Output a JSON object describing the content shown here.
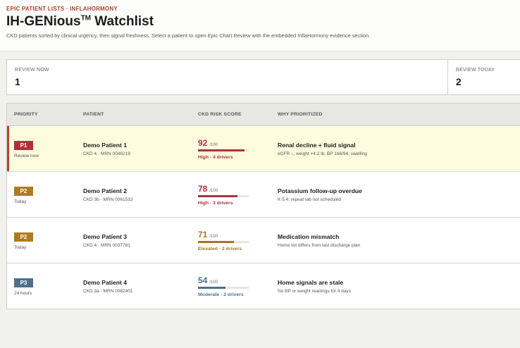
{
  "header": {
    "eyebrow": "EPIC PATIENT LISTS · INFLAHORMONY",
    "title": "IH-GENious",
    "title_mark": "TM",
    "title_rest": " Watchlist",
    "subtitle": "CKD patients sorted by clinical urgency, then signal freshness. Select a patient to open Epic Chart Review with the embedded InflaHormony evidence section."
  },
  "summary": {
    "review_now_label": "REVIEW NOW",
    "review_now_value": "1",
    "review_today_label": "REVIEW TODAY",
    "review_today_value": "2"
  },
  "table": {
    "columns": [
      "PRIORITY",
      "PATIENT",
      "CKD RISK SCORE",
      "WHY PRIORITIZED"
    ],
    "rows": [
      {
        "priority": "P1",
        "when": "Review now",
        "badge_color": "#b0303a",
        "name": "Demo Patient 1",
        "meta": "CKD 4 · MRN 0048219",
        "score": "92",
        "score_out_of": "/100",
        "score_fraction": 0.92,
        "score_color": "#a83242",
        "band": "High · 4 drivers",
        "why": "Renal decline + fluid signal",
        "detail": "eGFR ↓, weight +4.2 lb, BP 166/94, swelling",
        "highlight": true
      },
      {
        "priority": "P2",
        "when": "Today",
        "badge_color": "#b07a1f",
        "name": "Demo Patient 2",
        "meta": "CKD 3b · MRN 0061532",
        "score": "78",
        "score_out_of": "/100",
        "score_fraction": 0.78,
        "score_color": "#a83242",
        "band": "High · 3 drivers",
        "why": "Potassium follow-up overdue",
        "detail": "K 5.4; repeat lab not scheduled",
        "highlight": false
      },
      {
        "priority": "P2",
        "when": "Today",
        "badge_color": "#b07a1f",
        "name": "Demo Patient 3",
        "meta": "CKD 4 · MRN 0037781",
        "score": "71",
        "score_out_of": "/100",
        "score_fraction": 0.71,
        "score_color": "#a87424",
        "band": "Elevated · 2 drivers",
        "why": "Medication mismatch",
        "detail": "Home list differs from last discharge plan",
        "highlight": false
      },
      {
        "priority": "P3",
        "when": "24 hours",
        "badge_color": "#4f6f8a",
        "name": "Demo Patient 4",
        "meta": "CKD 3a · MRN 0082401",
        "score": "54",
        "score_out_of": "/100",
        "score_fraction": 0.54,
        "score_color": "#4f6f8a",
        "band": "Moderate · 2 drivers",
        "why": "Home signals are stale",
        "detail": "No BP or weight readings for 4 days",
        "highlight": false
      }
    ]
  }
}
